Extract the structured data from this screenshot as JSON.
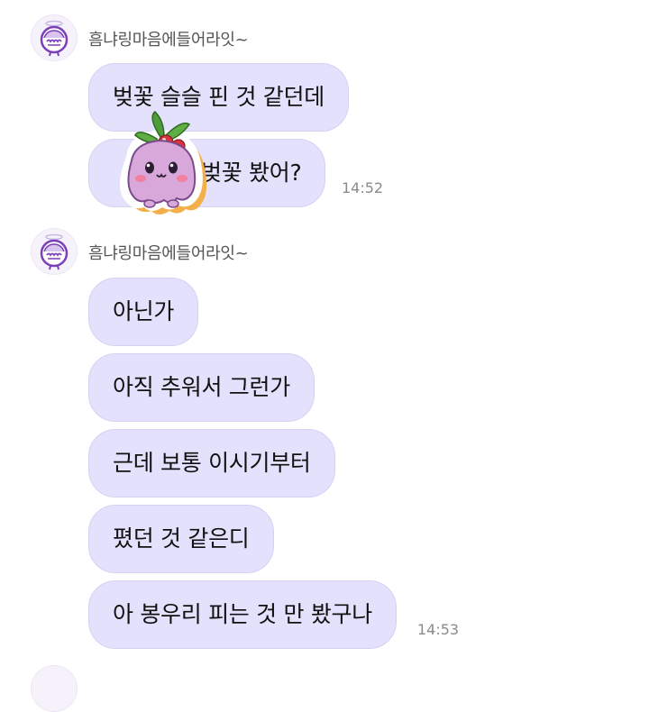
{
  "groups": [
    {
      "sender": "흠냐링마음에들어라잇~",
      "messages": [
        "벚꽃 슬슬 핀 것 같던데",
        "벚꽃 봤어?"
      ],
      "time": "14:52"
    },
    {
      "sender": "흠냐링마음에들어라잇~",
      "messages": [
        "아닌가",
        "아직 추워서 그런가",
        "근데 보통 이시기부터",
        "폈던 것 같은디",
        "아 봉우리 피는 것 만 봤구나"
      ],
      "time": "14:53"
    }
  ],
  "colors": {
    "bubble": "#e3e1fc",
    "bubble_border": "#d4d2f3",
    "avatar_outline": "#7b3fb8"
  },
  "icons": {
    "avatar": "cartoon-face-with-halo-icon",
    "sticker": "purple-radish-character-sticker"
  }
}
